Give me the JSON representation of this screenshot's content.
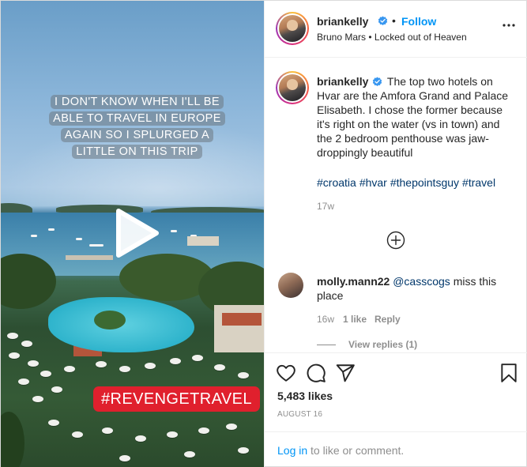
{
  "media": {
    "story_text": "I DON'T KNOW WHEN I'LL BE ABLE TO TRAVEL IN EUROPE AGAIN SO I SPLURGED A LITTLE ON THIS TRIP",
    "sticker": "#REVENGETRAVEL"
  },
  "header": {
    "username": "briankelly",
    "separator": "•",
    "follow_label": "Follow",
    "audio": "Bruno Mars • Locked out of Heaven"
  },
  "caption": {
    "username": "briankelly",
    "text": "The top two hotels on Hvar are the Amfora Grand and Palace Elisabeth. I chose the former because it's right on the water (vs in town) and the 2 bedroom penthouse was jaw-droppingly beautiful",
    "hashtags": [
      "#croatia",
      "#hvar",
      "#thepointsguy",
      "#travel"
    ],
    "time": "17w"
  },
  "comment": {
    "username": "molly.mann22",
    "mention": "@casscogs",
    "text": "miss this place",
    "time": "16w",
    "likes": "1 like",
    "reply_label": "Reply",
    "view_replies": "View replies (1)"
  },
  "actions": {
    "likes": "5,483 likes",
    "date": "AUGUST 16"
  },
  "login": {
    "link": "Log in",
    "text": " to like or comment."
  },
  "colors": {
    "accent": "#0095f6",
    "link_dark": "#00376b",
    "muted": "#8e8e8e",
    "sticker_red": "#e0202d"
  }
}
